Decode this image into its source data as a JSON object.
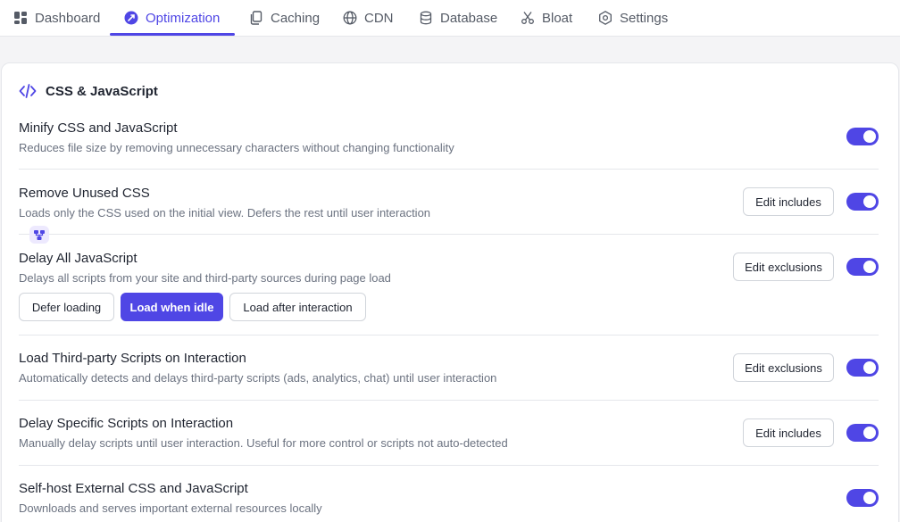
{
  "tabs": [
    {
      "label": "Dashboard",
      "icon": "dashboard-icon"
    },
    {
      "label": "Optimization",
      "icon": "optimization-icon",
      "active": true
    },
    {
      "label": "Caching",
      "icon": "caching-icon"
    },
    {
      "label": "CDN",
      "icon": "globe-icon"
    },
    {
      "label": "Database",
      "icon": "database-icon"
    },
    {
      "label": "Bloat",
      "icon": "scissors-icon"
    },
    {
      "label": "Settings",
      "icon": "gear-icon"
    }
  ],
  "section": {
    "title": "CSS & JavaScript",
    "icon": "code-icon"
  },
  "rows": [
    {
      "title": "Minify CSS and JavaScript",
      "description": "Reduces file size by removing unnecessary characters without changing functionality",
      "enabled": true
    },
    {
      "title": "Remove Unused CSS",
      "description": "Loads only the CSS used on the initial view. Defers the rest until user interaction",
      "button": "Edit includes",
      "enabled": true
    },
    {
      "title": "Delay All JavaScript",
      "description": "Delays all scripts from your site and third-party sources during page load",
      "button": "Edit exclusions",
      "enabled": true,
      "modes": [
        "Defer loading",
        "Load when idle",
        "Load after interaction"
      ],
      "selected_mode": "Load when idle"
    },
    {
      "title": "Load Third-party Scripts on Interaction",
      "description": "Automatically detects and delays third-party scripts (ads, analytics, chat) until user interaction",
      "button": "Edit exclusions",
      "enabled": true
    },
    {
      "title": "Delay Specific Scripts on Interaction",
      "description": "Manually delay scripts until user interaction. Useful for more control or scripts not auto-detected",
      "button": "Edit includes",
      "enabled": true
    },
    {
      "title": "Self-host External CSS and JavaScript",
      "description": "Downloads and serves important external resources locally",
      "enabled": true
    }
  ],
  "colors": {
    "accent": "#4f46e5",
    "badge_bg": "#ede9fe"
  }
}
